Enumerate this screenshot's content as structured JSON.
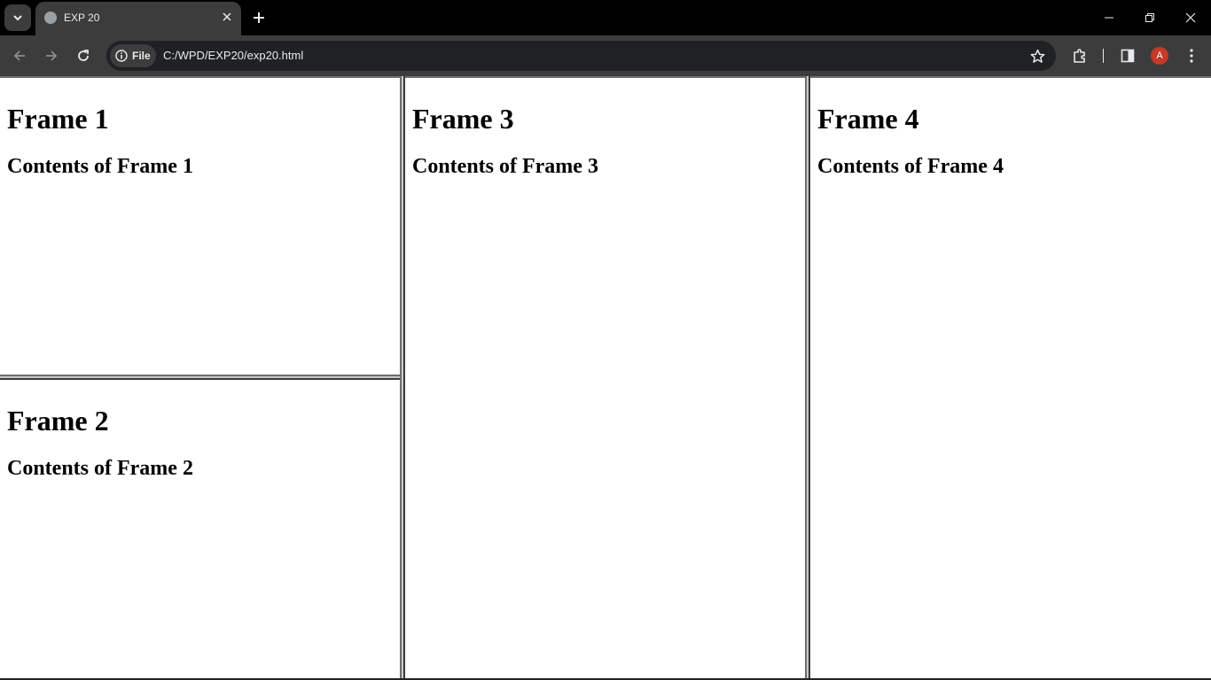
{
  "browser": {
    "tab": {
      "title": "EXP 20"
    },
    "omnibox": {
      "site_chip_label": "File",
      "url": "C:/WPD/EXP20/exp20.html"
    },
    "profile_initial": "A",
    "colors": {
      "avatar": "#c53929",
      "chrome": "#3c3c3c",
      "omnibox": "#202124"
    }
  },
  "frames": [
    {
      "heading": "Frame 1",
      "contents": "Contents of Frame 1"
    },
    {
      "heading": "Frame 2",
      "contents": "Contents of Frame 2"
    },
    {
      "heading": "Frame 3",
      "contents": "Contents of Frame 3"
    },
    {
      "heading": "Frame 4",
      "contents": "Contents of Frame 4"
    }
  ]
}
